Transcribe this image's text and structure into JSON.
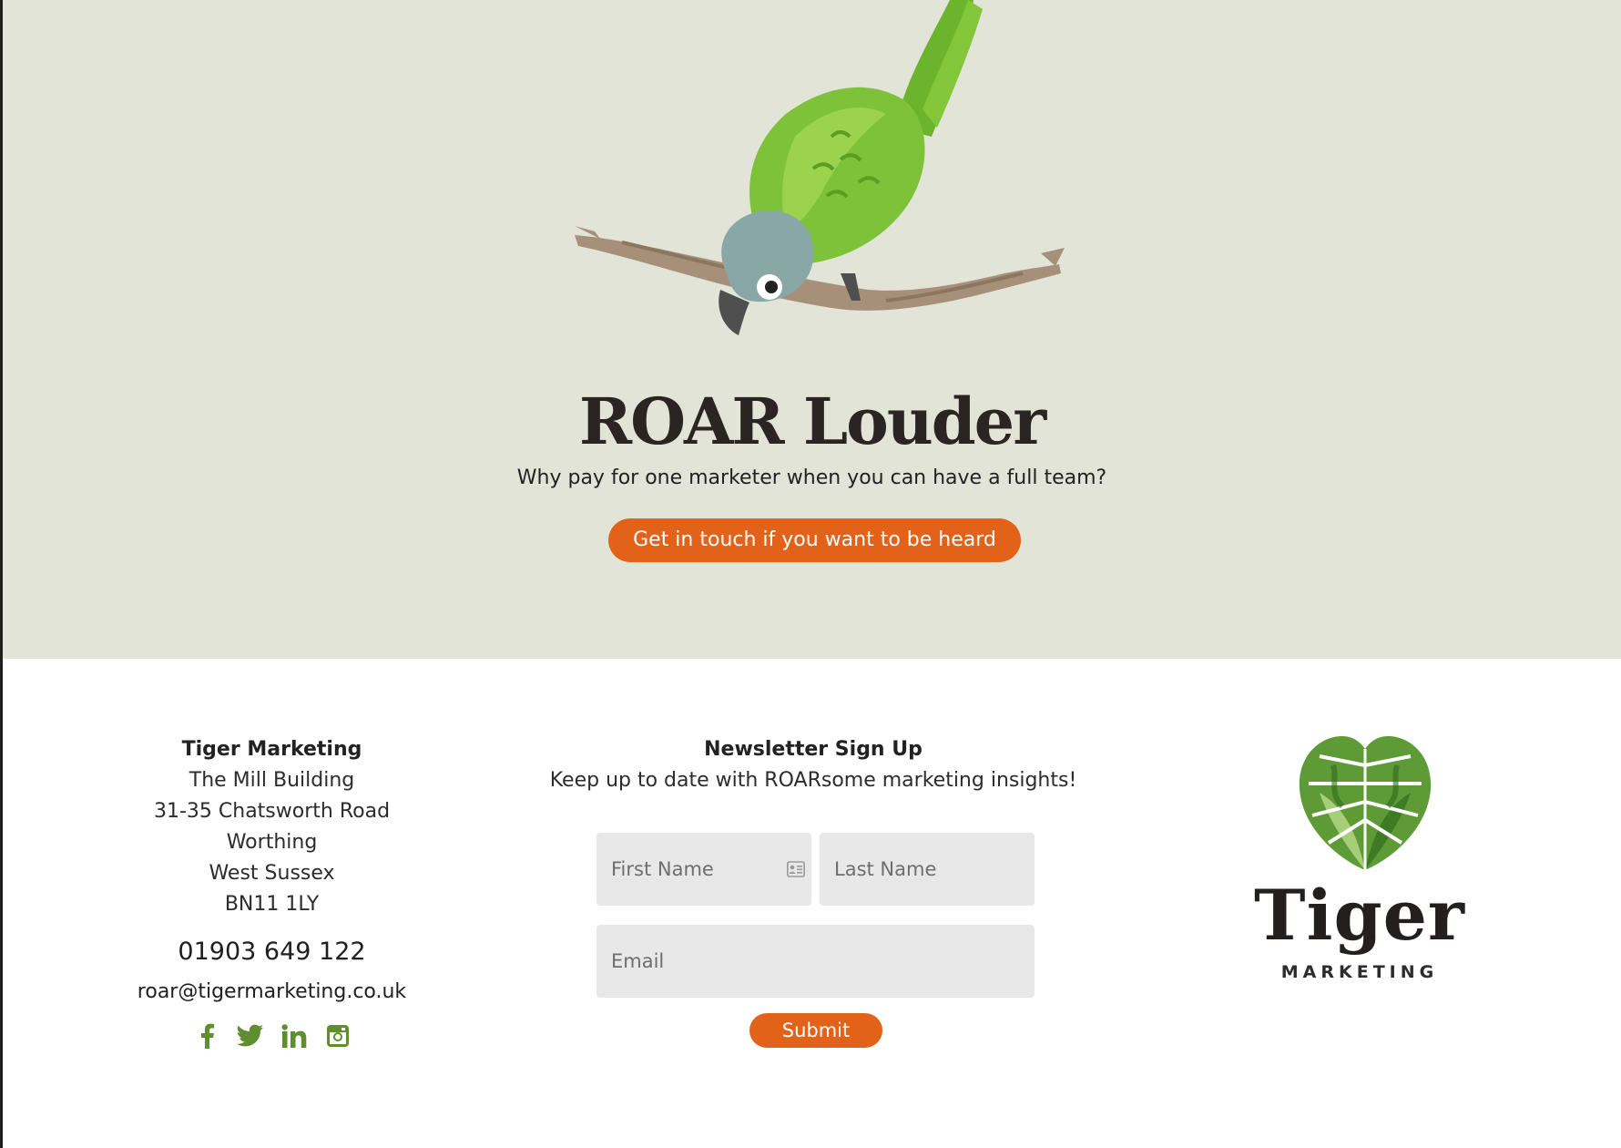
{
  "hero": {
    "title": "ROAR Louder",
    "subtitle": "Why pay for one marketer when you can have a full team?",
    "cta_label": "Get in touch if you want to be heard",
    "illustration": "parrot-on-branch"
  },
  "contact": {
    "company": "Tiger Marketing",
    "address": [
      "The Mill Building",
      "31-35 Chatsworth Road",
      "Worthing",
      "West Sussex",
      "BN11 1LY"
    ],
    "phone": "01903 649 122",
    "email": "roar@tigermarketing.co.uk",
    "socials": [
      "facebook-icon",
      "twitter-icon",
      "linkedin-icon",
      "instagram-icon"
    ]
  },
  "newsletter": {
    "title": "Newsletter Sign Up",
    "subtitle": "Keep up to date with ROARsome marketing insights!",
    "first_name_placeholder": "First Name",
    "last_name_placeholder": "Last Name",
    "email_placeholder": "Email",
    "submit_label": "Submit"
  },
  "logo": {
    "word": "Tiger",
    "sub": "MARKETING"
  },
  "colors": {
    "hero_bg": "#e1e4d6",
    "accent": "#e2621a",
    "social_green": "#5f8e2e",
    "field_bg": "#e9e8e9"
  }
}
